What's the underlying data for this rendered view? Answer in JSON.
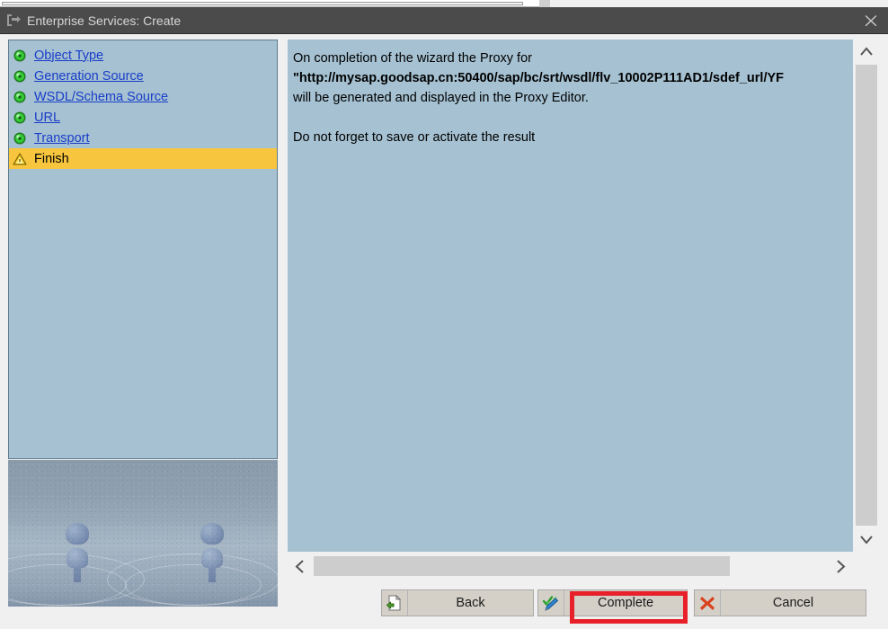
{
  "window": {
    "title": "Enterprise Services: Create",
    "title_icon": "pointer-bracket-icon",
    "close_icon": "close-icon"
  },
  "sidebar": {
    "items": [
      {
        "label": "Object Type",
        "icon": "green-completed-icon",
        "state": "completed"
      },
      {
        "label": "Generation Source",
        "icon": "green-completed-icon",
        "state": "completed"
      },
      {
        "label": "WSDL/Schema Source",
        "icon": "green-completed-icon",
        "state": "completed"
      },
      {
        "label": "URL",
        "icon": "green-completed-icon",
        "state": "completed"
      },
      {
        "label": "Transport",
        "icon": "green-completed-icon",
        "state": "completed"
      },
      {
        "label": "Finish",
        "icon": "warning-triangle-icon",
        "state": "current"
      }
    ],
    "highlight_color": "#f7c53e",
    "link_color": "#1a3ec8",
    "panel_color": "#a5c1d2"
  },
  "content": {
    "line1": "On completion of the wizard the Proxy for",
    "url": "\"http://mysap.goodsap.cn:50400/sap/bc/srt/wsdl/flv_10002P111AD1/sdef_url/YF",
    "line3": "will be generated and displayed in the Proxy Editor.",
    "line4": "Do not forget to save or activate the result"
  },
  "scrollbars": {
    "vertical": {
      "up_icon": "chevron-up-icon",
      "down_icon": "chevron-down-icon"
    },
    "horizontal": {
      "left_icon": "chevron-left-icon",
      "right_icon": "chevron-right-icon"
    }
  },
  "footer": {
    "back": {
      "label": "Back",
      "icon": "page-back-icon"
    },
    "complete": {
      "label": "Complete",
      "icon": "check-pencil-icon",
      "highlighted": true
    },
    "cancel": {
      "label": "Cancel",
      "icon": "red-x-icon"
    }
  },
  "annotation": {
    "color": "#e8202a",
    "target": "complete"
  }
}
